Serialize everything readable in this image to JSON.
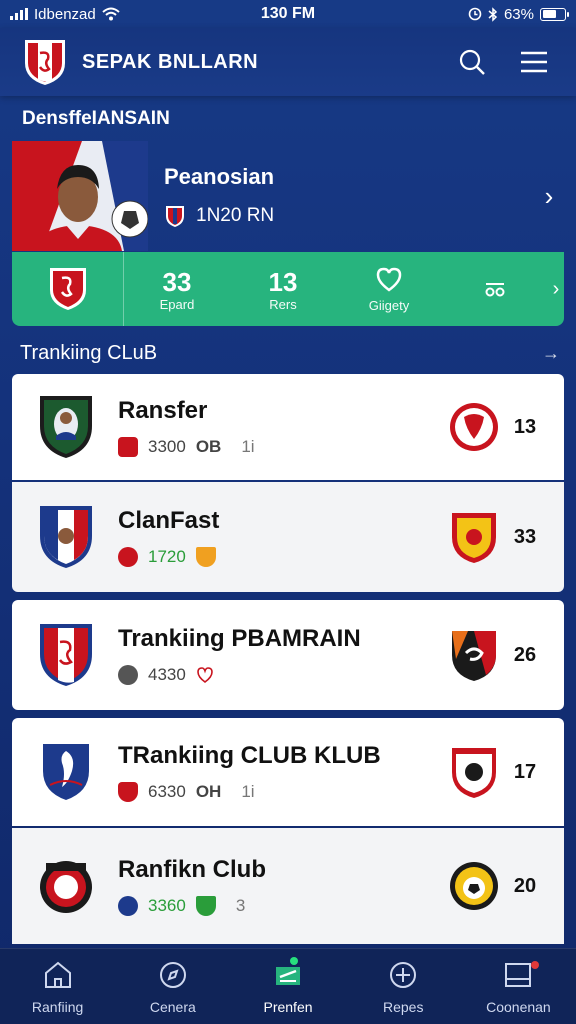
{
  "status": {
    "carrier": "Idbenzad",
    "time": "130 FM",
    "battery": "63%",
    "battery_level": 0.63
  },
  "header": {
    "title": "SEPAK BNLLARN"
  },
  "featured": {
    "section_label": "DensffeIANSAIN",
    "name": "Peanosian",
    "meta": "1N20 RN"
  },
  "stats": [
    {
      "value": "33",
      "label": "Epard"
    },
    {
      "value": "13",
      "label": "Rers"
    },
    {
      "value": "",
      "label": "Giigety"
    },
    {
      "value": "",
      "label": ""
    }
  ],
  "ranking": {
    "title": "Trankiing CLuB",
    "items": [
      {
        "title": "Ransfer",
        "value": "3300",
        "value2": "OB",
        "extra": "1i",
        "score": "13",
        "crest_color": "#1c5a2f",
        "opp_color": "#c8141e"
      },
      {
        "title": "ClanFast",
        "value": "1720",
        "value2": "",
        "extra": "",
        "score": "33",
        "crest_color": "#1d3a8c",
        "opp_color": "#c8141e"
      },
      {
        "title": "Trankiing PBAMRAIN",
        "value": "4330",
        "value2": "",
        "extra": "",
        "score": "26",
        "crest_color": "#c8141e",
        "opp_color": "#e76f1a"
      },
      {
        "title": "TRankiing CLUB KLUB",
        "value": "6330",
        "value2": "OH",
        "extra": "1i",
        "score": "17",
        "crest_color": "#1d3a8c",
        "opp_color": "#c8141e"
      },
      {
        "title": "Ranfikn Club",
        "value": "3360",
        "value2": "",
        "extra": "3",
        "score": "20",
        "crest_color": "#1a1a1a",
        "opp_color": "#f3c316"
      }
    ]
  },
  "nav": [
    {
      "label": "Ranfiing",
      "icon": "home-icon"
    },
    {
      "label": "Cenera",
      "icon": "compass-icon"
    },
    {
      "label": "Prenfen",
      "icon": "ticket-icon"
    },
    {
      "label": "Repes",
      "icon": "plus-circle-icon"
    },
    {
      "label": "Coonenan",
      "icon": "inbox-icon"
    }
  ],
  "colors": {
    "bg": "#173a86",
    "accent_green": "#27b47e",
    "nav_bg": "#102458",
    "brand_red": "#c8141e"
  }
}
